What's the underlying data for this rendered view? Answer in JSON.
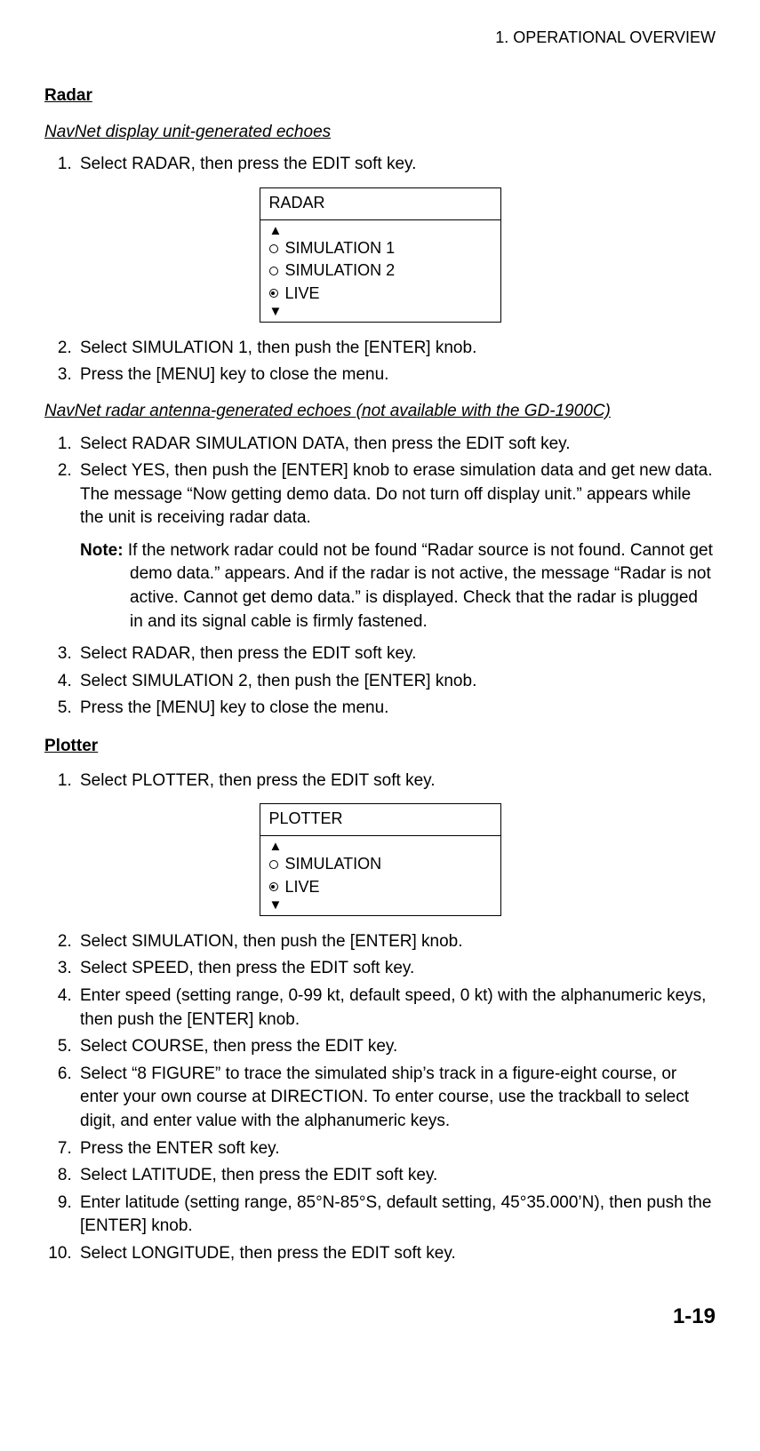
{
  "header": "1. OPERATIONAL OVERVIEW",
  "radar": {
    "heading": "Radar",
    "sub1": "NavNet display unit-generated echoes",
    "steps1": [
      "Select RADAR, then press the EDIT soft key."
    ],
    "menu1": {
      "title": "RADAR",
      "items": [
        {
          "label": "SIMULATION 1",
          "selected": false
        },
        {
          "label": "SIMULATION  2",
          "selected": false
        },
        {
          "label": "LIVE",
          "selected": true
        }
      ]
    },
    "steps1b": [
      "Select SIMULATION 1, then push the [ENTER] knob.",
      "Press the [MENU] key to close the menu."
    ],
    "sub2": "NavNet radar antenna-generated echoes (not available with the GD-1900C)",
    "steps2a": [
      "Select RADAR SIMULATION DATA, then press the EDIT soft key.",
      "Select YES, then push the [ENTER] knob to erase simulation data and get new data. The message “Now getting demo data. Do not turn off display unit.” appears while the unit is receiving radar data."
    ],
    "note_label": "Note:",
    "note_text": " If the network radar could not be found “Radar source is not found. Cannot get demo data.” appears. And if the radar is not active, the message “Radar is not active. Cannot get demo data.” is displayed. Check that the radar is plugged in and its signal cable is firmly fastened.",
    "steps2b": [
      "Select RADAR, then press the EDIT soft key.",
      "Select SIMULATION 2, then push the [ENTER] knob.",
      "Press the [MENU] key to close the menu."
    ]
  },
  "plotter": {
    "heading": "Plotter",
    "steps1": [
      "Select PLOTTER, then press the EDIT soft key."
    ],
    "menu1": {
      "title": "PLOTTER",
      "items": [
        {
          "label": "SIMULATION",
          "selected": false
        },
        {
          "label": "LIVE",
          "selected": true
        }
      ]
    },
    "steps2": [
      "Select SIMULATION, then push the [ENTER] knob.",
      "Select SPEED, then press the EDIT soft key.",
      "Enter speed (setting range, 0-99 kt, default speed, 0 kt) with the alphanumeric keys, then push the [ENTER] knob.",
      "Select COURSE, then press the EDIT key.",
      "Select “8 FIGURE” to trace the simulated ship’s track in a figure-eight course, or enter your own course at DIRECTION. To enter course, use the trackball to select digit, and enter value with the alphanumeric keys.",
      "Press the ENTER soft key.",
      "Select LATITUDE, then press the EDIT soft key.",
      "Enter latitude (setting range, 85°N-85°S, default setting, 45°35.000’N), then push the [ENTER] knob.",
      "Select LONGITUDE, then press the EDIT soft key."
    ]
  },
  "page_number": "1-19"
}
